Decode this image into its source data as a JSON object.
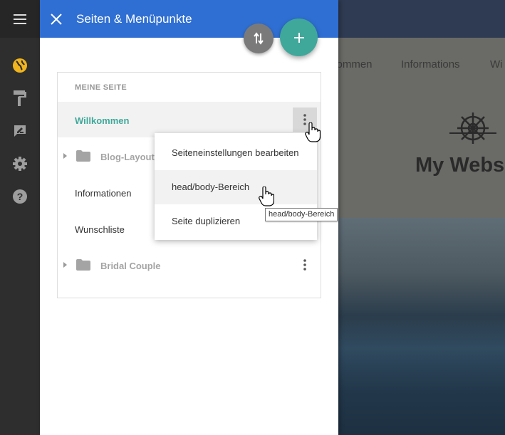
{
  "rail": {
    "icons": [
      "menu-icon",
      "globe-icon",
      "paint-roller-icon",
      "edit-icon",
      "gear-icon",
      "help-icon"
    ],
    "active_color": "#f0b41e",
    "icon_color": "#9e9e9e"
  },
  "panel": {
    "title": "Seiten & Menüpunkte",
    "header_color": "#2f6fd3",
    "accent": "#3fa89a"
  },
  "pages": {
    "section_label": "MEINE SEITE",
    "items": [
      {
        "label": "Willkommen",
        "active": true,
        "type": "page"
      },
      {
        "label": "Blog-Layout",
        "type": "folder"
      },
      {
        "label": "Informationen",
        "type": "page"
      },
      {
        "label": "Wunschliste",
        "type": "page"
      },
      {
        "label": "Bridal Couple",
        "type": "folder"
      }
    ]
  },
  "context_menu": {
    "items": [
      "Seiteneinstellungen bearbeiten",
      "head/body-Bereich",
      "Seite duplizieren"
    ],
    "hovered_index": 1
  },
  "tooltip": "head/body-Bereich",
  "site_preview": {
    "nav": [
      "Willkommen",
      "Informations",
      "Wi"
    ],
    "title": "My Webs"
  }
}
